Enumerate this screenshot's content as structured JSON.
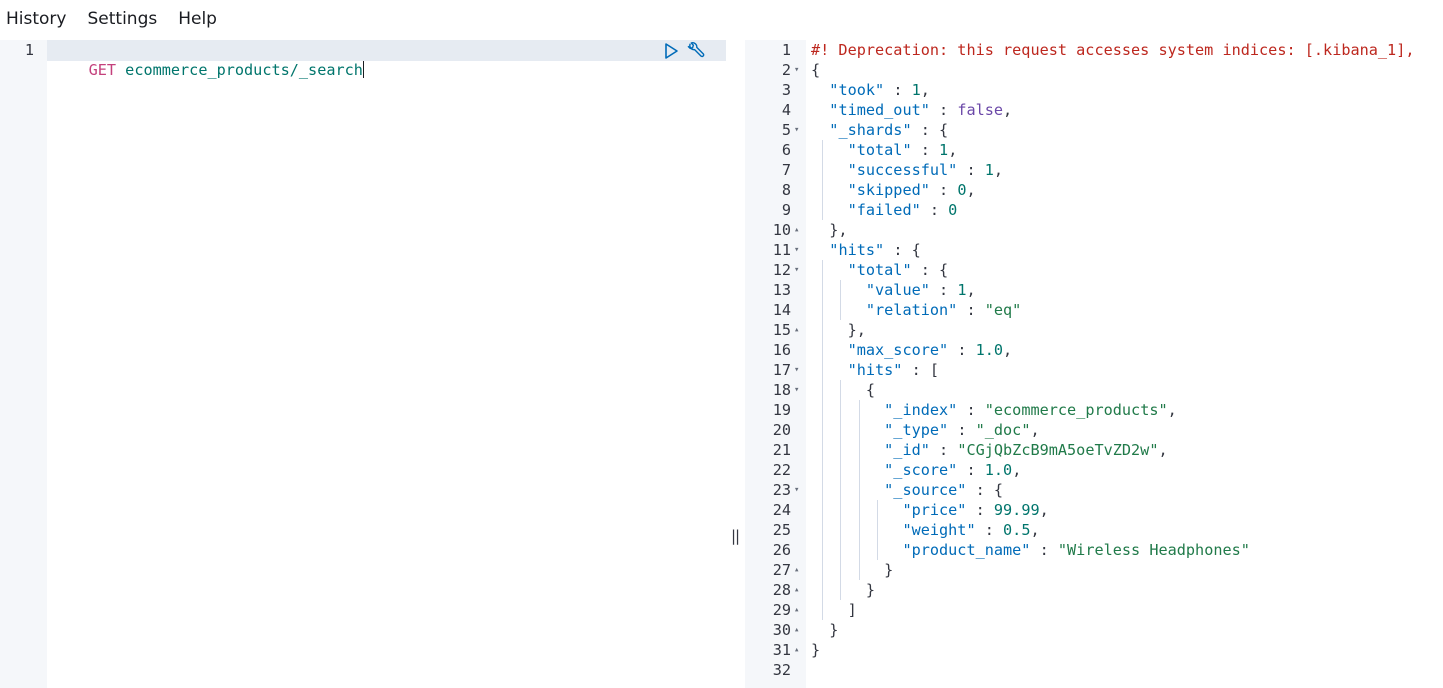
{
  "menu": {
    "items": [
      {
        "label": "History"
      },
      {
        "label": "Settings"
      },
      {
        "label": "Help"
      }
    ]
  },
  "request_editor": {
    "line_number": "1",
    "method": "GET",
    "path": "ecommerce_products/_search"
  },
  "response": {
    "line_numbers": [
      "1",
      "2",
      "3",
      "4",
      "5",
      "6",
      "7",
      "8",
      "9",
      "10",
      "11",
      "12",
      "13",
      "14",
      "15",
      "16",
      "17",
      "18",
      "19",
      "20",
      "21",
      "22",
      "23",
      "24",
      "25",
      "26",
      "27",
      "28",
      "29",
      "30",
      "31",
      "32"
    ],
    "lines": [
      [
        [
          "c",
          "#! Deprecation: this request accesses system indices: [.kibana_1],"
        ]
      ],
      [
        [
          "p",
          "{"
        ]
      ],
      [
        [
          "p",
          "  "
        ],
        [
          "k",
          "\"took\""
        ],
        [
          "p",
          " : "
        ],
        [
          "n",
          "1"
        ],
        [
          "p",
          ","
        ]
      ],
      [
        [
          "p",
          "  "
        ],
        [
          "k",
          "\"timed_out\""
        ],
        [
          "p",
          " : "
        ],
        [
          "b",
          "false"
        ],
        [
          "p",
          ","
        ]
      ],
      [
        [
          "p",
          "  "
        ],
        [
          "k",
          "\"_shards\""
        ],
        [
          "p",
          " : {"
        ]
      ],
      [
        [
          "p",
          "    "
        ],
        [
          "k",
          "\"total\""
        ],
        [
          "p",
          " : "
        ],
        [
          "n",
          "1"
        ],
        [
          "p",
          ","
        ]
      ],
      [
        [
          "p",
          "    "
        ],
        [
          "k",
          "\"successful\""
        ],
        [
          "p",
          " : "
        ],
        [
          "n",
          "1"
        ],
        [
          "p",
          ","
        ]
      ],
      [
        [
          "p",
          "    "
        ],
        [
          "k",
          "\"skipped\""
        ],
        [
          "p",
          " : "
        ],
        [
          "n",
          "0"
        ],
        [
          "p",
          ","
        ]
      ],
      [
        [
          "p",
          "    "
        ],
        [
          "k",
          "\"failed\""
        ],
        [
          "p",
          " : "
        ],
        [
          "n",
          "0"
        ]
      ],
      [
        [
          "p",
          "  },"
        ]
      ],
      [
        [
          "p",
          "  "
        ],
        [
          "k",
          "\"hits\""
        ],
        [
          "p",
          " : {"
        ]
      ],
      [
        [
          "p",
          "    "
        ],
        [
          "k",
          "\"total\""
        ],
        [
          "p",
          " : {"
        ]
      ],
      [
        [
          "p",
          "      "
        ],
        [
          "k",
          "\"value\""
        ],
        [
          "p",
          " : "
        ],
        [
          "n",
          "1"
        ],
        [
          "p",
          ","
        ]
      ],
      [
        [
          "p",
          "      "
        ],
        [
          "k",
          "\"relation\""
        ],
        [
          "p",
          " : "
        ],
        [
          "s",
          "\"eq\""
        ]
      ],
      [
        [
          "p",
          "    },"
        ]
      ],
      [
        [
          "p",
          "    "
        ],
        [
          "k",
          "\"max_score\""
        ],
        [
          "p",
          " : "
        ],
        [
          "n",
          "1.0"
        ],
        [
          "p",
          ","
        ]
      ],
      [
        [
          "p",
          "    "
        ],
        [
          "k",
          "\"hits\""
        ],
        [
          "p",
          " : ["
        ]
      ],
      [
        [
          "p",
          "      {"
        ]
      ],
      [
        [
          "p",
          "        "
        ],
        [
          "k",
          "\"_index\""
        ],
        [
          "p",
          " : "
        ],
        [
          "s",
          "\"ecommerce_products\""
        ],
        [
          "p",
          ","
        ]
      ],
      [
        [
          "p",
          "        "
        ],
        [
          "k",
          "\"_type\""
        ],
        [
          "p",
          " : "
        ],
        [
          "s",
          "\"_doc\""
        ],
        [
          "p",
          ","
        ]
      ],
      [
        [
          "p",
          "        "
        ],
        [
          "k",
          "\"_id\""
        ],
        [
          "p",
          " : "
        ],
        [
          "s",
          "\"CGjQbZcB9mA5oeTvZD2w\""
        ],
        [
          "p",
          ","
        ]
      ],
      [
        [
          "p",
          "        "
        ],
        [
          "k",
          "\"_score\""
        ],
        [
          "p",
          " : "
        ],
        [
          "n",
          "1.0"
        ],
        [
          "p",
          ","
        ]
      ],
      [
        [
          "p",
          "        "
        ],
        [
          "k",
          "\"_source\""
        ],
        [
          "p",
          " : {"
        ]
      ],
      [
        [
          "p",
          "          "
        ],
        [
          "k",
          "\"price\""
        ],
        [
          "p",
          " : "
        ],
        [
          "n",
          "99.99"
        ],
        [
          "p",
          ","
        ]
      ],
      [
        [
          "p",
          "          "
        ],
        [
          "k",
          "\"weight\""
        ],
        [
          "p",
          " : "
        ],
        [
          "n",
          "0.5"
        ],
        [
          "p",
          ","
        ]
      ],
      [
        [
          "p",
          "          "
        ],
        [
          "k",
          "\"product_name\""
        ],
        [
          "p",
          " : "
        ],
        [
          "s",
          "\"Wireless Headphones\""
        ]
      ],
      [
        [
          "p",
          "        }"
        ]
      ],
      [
        [
          "p",
          "      }"
        ]
      ],
      [
        [
          "p",
          "    ]"
        ]
      ],
      [
        [
          "p",
          "  }"
        ]
      ],
      [
        [
          "p",
          "}"
        ]
      ],
      [
        [
          "p",
          ""
        ]
      ]
    ],
    "folds": [
      {
        "line": 2,
        "dir": "down"
      },
      {
        "line": 5,
        "dir": "down"
      },
      {
        "line": 10,
        "dir": "up"
      },
      {
        "line": 11,
        "dir": "down"
      },
      {
        "line": 12,
        "dir": "down"
      },
      {
        "line": 15,
        "dir": "up"
      },
      {
        "line": 17,
        "dir": "down"
      },
      {
        "line": 18,
        "dir": "down"
      },
      {
        "line": 23,
        "dir": "down"
      },
      {
        "line": 27,
        "dir": "up"
      },
      {
        "line": 28,
        "dir": "up"
      },
      {
        "line": 29,
        "dir": "up"
      },
      {
        "line": 30,
        "dir": "up"
      },
      {
        "line": 31,
        "dir": "up"
      }
    ],
    "guides": [
      {
        "depth": 1,
        "from": 6,
        "to": 9
      },
      {
        "depth": 1,
        "from": 12,
        "to": 29
      },
      {
        "depth": 2,
        "from": 13,
        "to": 14
      },
      {
        "depth": 2,
        "from": 18,
        "to": 28
      },
      {
        "depth": 3,
        "from": 19,
        "to": 27
      },
      {
        "depth": 4,
        "from": 24,
        "to": 26
      }
    ]
  },
  "icons": {
    "run": "play-icon",
    "wrench": "wrench-icon",
    "fold_down": "fold-open-icon",
    "fold_up": "fold-close-icon"
  },
  "colors": {
    "accent": "#006bb8",
    "comment": "#bd271e",
    "method": "#c4407c",
    "string": "#207a49",
    "number": "#00756c"
  }
}
